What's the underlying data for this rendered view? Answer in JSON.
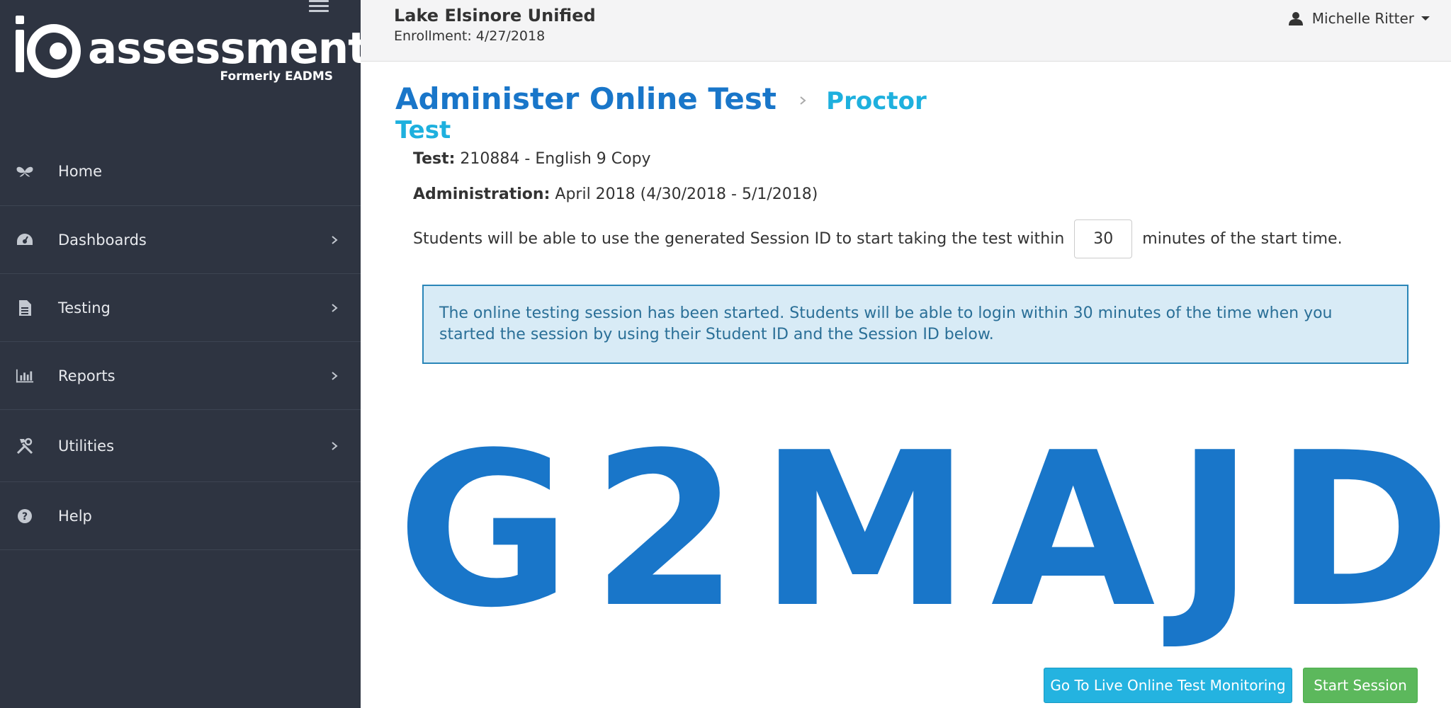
{
  "sidebar": {
    "logo": {
      "brand": "assessment",
      "subtitle": "Formerly EADMS"
    },
    "items": [
      {
        "label": "Home",
        "icon": "butterfly-icon",
        "has_submenu": false
      },
      {
        "label": "Dashboards",
        "icon": "dashboard-gauge-icon",
        "has_submenu": true
      },
      {
        "label": "Testing",
        "icon": "document-icon",
        "has_submenu": true
      },
      {
        "label": "Reports",
        "icon": "bar-chart-icon",
        "has_submenu": true
      },
      {
        "label": "Utilities",
        "icon": "tools-icon",
        "has_submenu": true
      },
      {
        "label": "Help",
        "icon": "question-circle-icon",
        "has_submenu": false
      }
    ]
  },
  "header": {
    "district": "Lake Elsinore Unified",
    "enrollment": "Enrollment: 4/27/2018",
    "user_name": "Michelle Ritter"
  },
  "breadcrumb": {
    "title": "Administer Online Test",
    "current": "Proctor Test"
  },
  "details": {
    "test_label": "Test:",
    "test_value": "210884 - English 9 Copy",
    "admin_label": "Administration:",
    "admin_value": "April 2018 (4/30/2018 - 5/1/2018)",
    "students_before": "Students will be able to use the generated Session ID to start taking the test within",
    "minutes_value": "30",
    "students_after": "minutes of the start time."
  },
  "alert": {
    "message": "The online testing session has been started. Students will be able to login within 30 minutes of the time when you started the session by using their Student ID and the Session ID below."
  },
  "session_id": [
    "G",
    "2",
    "M",
    "A",
    "J",
    "D"
  ],
  "buttons": {
    "monitor": "Go To Live Online Test Monitoring",
    "start": "Start Session"
  },
  "colors": {
    "sidebar_bg": "#2e3441",
    "primary_blue": "#1976c9",
    "accent_cyan": "#1eb0de",
    "alert_bg": "#d8ebf6",
    "success_green": "#5cb85c"
  }
}
